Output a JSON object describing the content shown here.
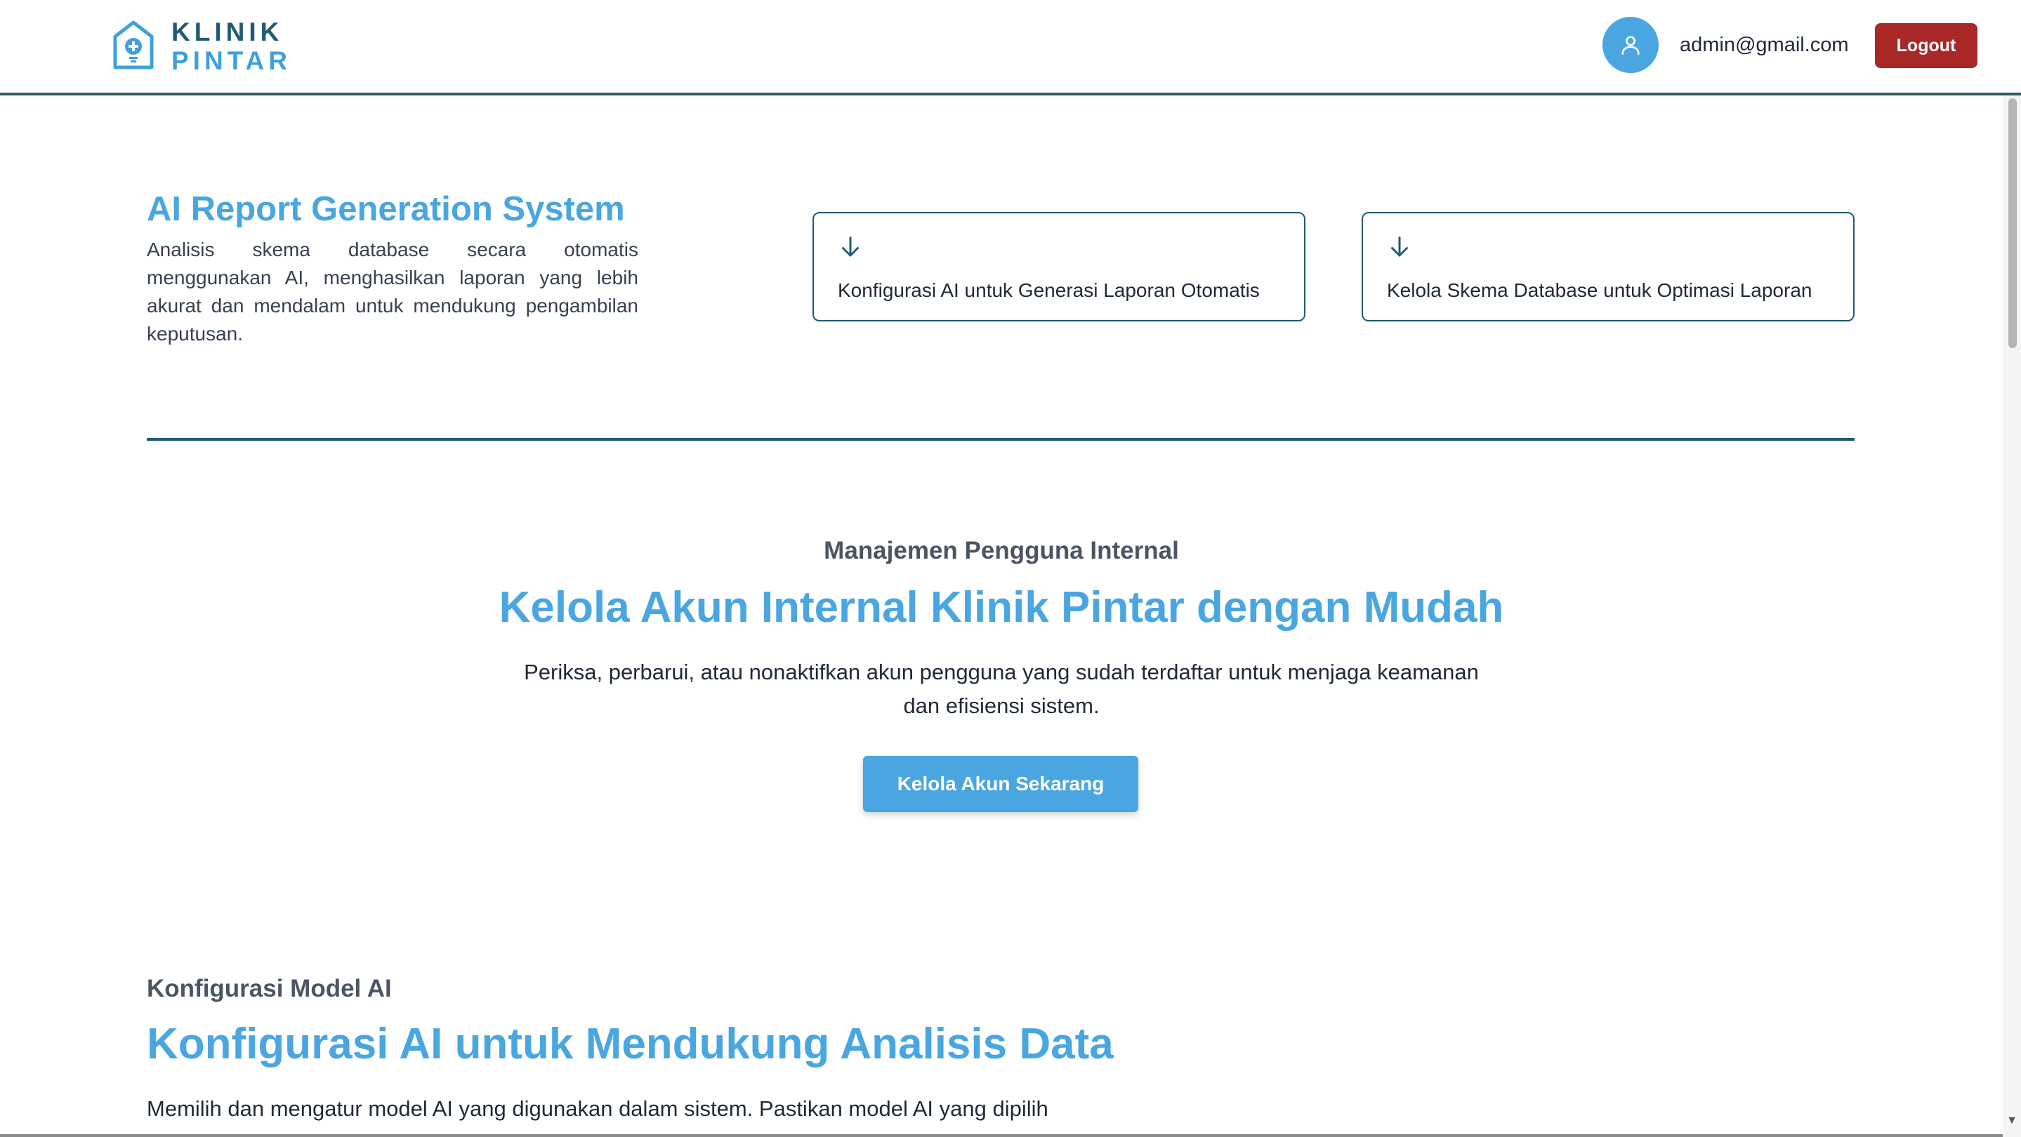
{
  "header": {
    "logo": {
      "line1": "KLINIK",
      "line2": "PINTAR"
    },
    "user_email": "admin@gmail.com",
    "logout_label": "Logout"
  },
  "ai_section": {
    "title": "AI Report Generation System",
    "description": "Analisis skema database secara otomatis menggunakan AI, menghasilkan laporan yang lebih akurat dan mendalam untuk mendukung pengambilan keputusan.",
    "cards": [
      {
        "label": "Konfigurasi AI untuk Generasi Laporan Otomatis",
        "icon": "arrow-down-icon"
      },
      {
        "label": "Kelola Skema Database untuk Optimasi Laporan",
        "icon": "arrow-down-icon"
      }
    ]
  },
  "user_management": {
    "subtitle": "Manajemen Pengguna Internal",
    "title": "Kelola Akun Internal Klinik Pintar dengan Mudah",
    "description": "Periksa, perbarui, atau nonaktifkan akun pengguna yang sudah terdaftar untuk menjaga keamanan dan efisiensi sistem.",
    "button_label": "Kelola Akun Sekarang"
  },
  "model_config": {
    "subtitle": "Konfigurasi Model AI",
    "title": "Konfigurasi AI untuk Mendukung Analisis Data",
    "description": "Memilih dan mengatur model AI yang digunakan dalam sistem. Pastikan model AI yang dipilih"
  },
  "colors": {
    "primary": "#4aa6e0",
    "dark_teal": "#215a73",
    "logout_red": "#a82828",
    "header_border": "#2e5c5a"
  }
}
